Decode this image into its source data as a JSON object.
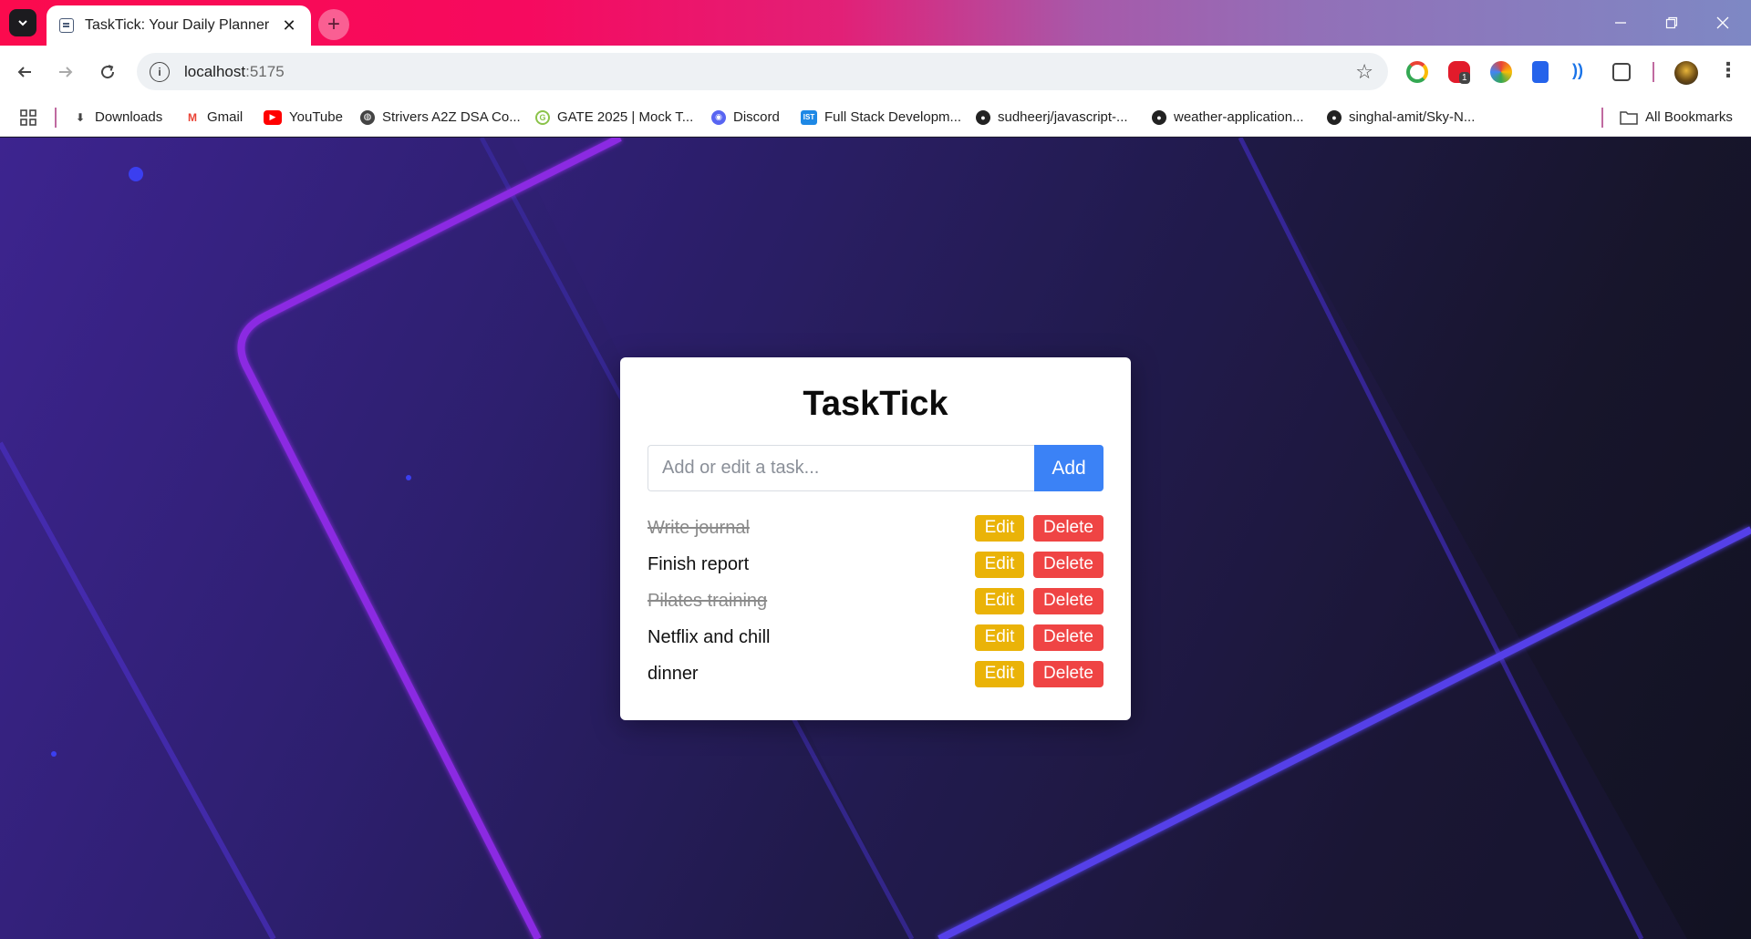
{
  "browser": {
    "tab": {
      "title": "TaskTick: Your Daily Planner"
    },
    "omnibox": {
      "host": "localhost",
      "port": ":5175"
    },
    "extensions": {
      "badge_count": "1"
    },
    "bookmarks": [
      {
        "label": "Downloads",
        "icon": "download-icon"
      },
      {
        "label": "Gmail",
        "icon": "gmail-icon"
      },
      {
        "label": "YouTube",
        "icon": "youtube-icon"
      },
      {
        "label": "Strivers A2Z DSA Co...",
        "icon": "globe-icon"
      },
      {
        "label": "GATE 2025 | Mock T...",
        "icon": "gate-icon"
      },
      {
        "label": "Discord",
        "icon": "discord-icon"
      },
      {
        "label": "Full Stack Developm...",
        "icon": "ist-icon"
      },
      {
        "label": "sudheerj/javascript-...",
        "icon": "github-icon"
      },
      {
        "label": "weather-application...",
        "icon": "github-icon"
      },
      {
        "label": "singhal-amit/Sky-N...",
        "icon": "github-icon"
      }
    ],
    "all_bookmarks_label": "All Bookmarks"
  },
  "app": {
    "title": "TaskTick",
    "input": {
      "placeholder": "Add or edit a task...",
      "value": ""
    },
    "add_label": "Add",
    "edit_label": "Edit",
    "delete_label": "Delete",
    "tasks": [
      {
        "text": "Write journal",
        "completed": true
      },
      {
        "text": "Finish report",
        "completed": false
      },
      {
        "text": "Pilates training",
        "completed": true
      },
      {
        "text": "Netflix and chill",
        "completed": false
      },
      {
        "text": "dinner",
        "completed": false
      }
    ]
  },
  "colors": {
    "add_button": "#3b82f6",
    "edit_button": "#eab308",
    "delete_button": "#ef4444",
    "accent_line": "#8b2be2"
  }
}
